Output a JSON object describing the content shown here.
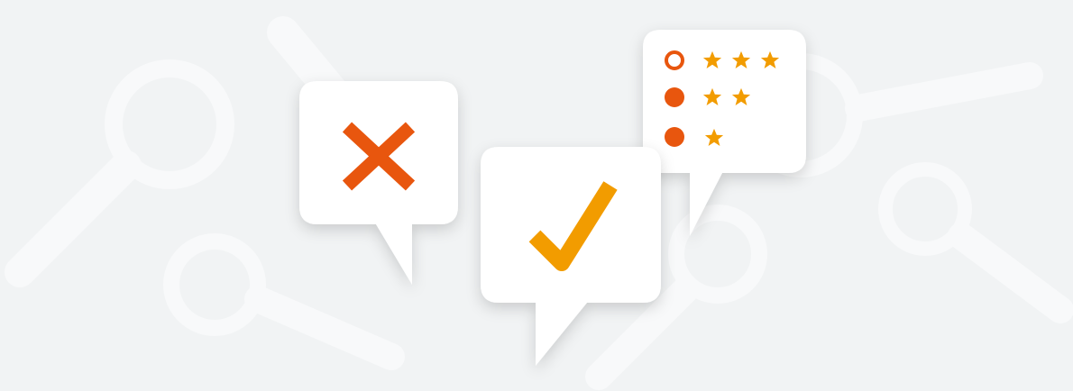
{
  "colors": {
    "background": "#f1f3f4",
    "watermark": "#f8f9fa",
    "bubble": "#ffffff",
    "cross": "#e8560e",
    "check": "#f29c00",
    "dot": "#e8560e",
    "star": "#f29c00"
  },
  "illustration": {
    "icons": [
      "magnifier-icon",
      "cross-icon",
      "check-icon",
      "radio-dot-icon",
      "star-icon"
    ],
    "rating_options": [
      {
        "stars": 3,
        "selected": false
      },
      {
        "stars": 2,
        "selected": true
      },
      {
        "stars": 1,
        "selected": true
      }
    ]
  }
}
